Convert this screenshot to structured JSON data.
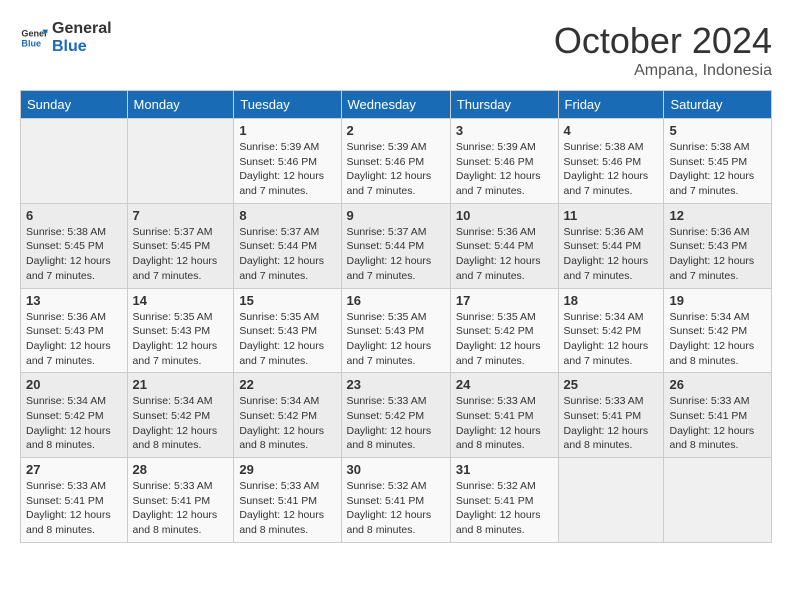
{
  "logo": {
    "text_general": "General",
    "text_blue": "Blue"
  },
  "header": {
    "month": "October 2024",
    "location": "Ampana, Indonesia"
  },
  "days_of_week": [
    "Sunday",
    "Monday",
    "Tuesday",
    "Wednesday",
    "Thursday",
    "Friday",
    "Saturday"
  ],
  "weeks": [
    [
      {
        "day": "",
        "info": ""
      },
      {
        "day": "",
        "info": ""
      },
      {
        "day": "1",
        "info": "Sunrise: 5:39 AM\nSunset: 5:46 PM\nDaylight: 12 hours\nand 7 minutes."
      },
      {
        "day": "2",
        "info": "Sunrise: 5:39 AM\nSunset: 5:46 PM\nDaylight: 12 hours\nand 7 minutes."
      },
      {
        "day": "3",
        "info": "Sunrise: 5:39 AM\nSunset: 5:46 PM\nDaylight: 12 hours\nand 7 minutes."
      },
      {
        "day": "4",
        "info": "Sunrise: 5:38 AM\nSunset: 5:46 PM\nDaylight: 12 hours\nand 7 minutes."
      },
      {
        "day": "5",
        "info": "Sunrise: 5:38 AM\nSunset: 5:45 PM\nDaylight: 12 hours\nand 7 minutes."
      }
    ],
    [
      {
        "day": "6",
        "info": "Sunrise: 5:38 AM\nSunset: 5:45 PM\nDaylight: 12 hours\nand 7 minutes."
      },
      {
        "day": "7",
        "info": "Sunrise: 5:37 AM\nSunset: 5:45 PM\nDaylight: 12 hours\nand 7 minutes."
      },
      {
        "day": "8",
        "info": "Sunrise: 5:37 AM\nSunset: 5:44 PM\nDaylight: 12 hours\nand 7 minutes."
      },
      {
        "day": "9",
        "info": "Sunrise: 5:37 AM\nSunset: 5:44 PM\nDaylight: 12 hours\nand 7 minutes."
      },
      {
        "day": "10",
        "info": "Sunrise: 5:36 AM\nSunset: 5:44 PM\nDaylight: 12 hours\nand 7 minutes."
      },
      {
        "day": "11",
        "info": "Sunrise: 5:36 AM\nSunset: 5:44 PM\nDaylight: 12 hours\nand 7 minutes."
      },
      {
        "day": "12",
        "info": "Sunrise: 5:36 AM\nSunset: 5:43 PM\nDaylight: 12 hours\nand 7 minutes."
      }
    ],
    [
      {
        "day": "13",
        "info": "Sunrise: 5:36 AM\nSunset: 5:43 PM\nDaylight: 12 hours\nand 7 minutes."
      },
      {
        "day": "14",
        "info": "Sunrise: 5:35 AM\nSunset: 5:43 PM\nDaylight: 12 hours\nand 7 minutes."
      },
      {
        "day": "15",
        "info": "Sunrise: 5:35 AM\nSunset: 5:43 PM\nDaylight: 12 hours\nand 7 minutes."
      },
      {
        "day": "16",
        "info": "Sunrise: 5:35 AM\nSunset: 5:43 PM\nDaylight: 12 hours\nand 7 minutes."
      },
      {
        "day": "17",
        "info": "Sunrise: 5:35 AM\nSunset: 5:42 PM\nDaylight: 12 hours\nand 7 minutes."
      },
      {
        "day": "18",
        "info": "Sunrise: 5:34 AM\nSunset: 5:42 PM\nDaylight: 12 hours\nand 7 minutes."
      },
      {
        "day": "19",
        "info": "Sunrise: 5:34 AM\nSunset: 5:42 PM\nDaylight: 12 hours\nand 8 minutes."
      }
    ],
    [
      {
        "day": "20",
        "info": "Sunrise: 5:34 AM\nSunset: 5:42 PM\nDaylight: 12 hours\nand 8 minutes."
      },
      {
        "day": "21",
        "info": "Sunrise: 5:34 AM\nSunset: 5:42 PM\nDaylight: 12 hours\nand 8 minutes."
      },
      {
        "day": "22",
        "info": "Sunrise: 5:34 AM\nSunset: 5:42 PM\nDaylight: 12 hours\nand 8 minutes."
      },
      {
        "day": "23",
        "info": "Sunrise: 5:33 AM\nSunset: 5:42 PM\nDaylight: 12 hours\nand 8 minutes."
      },
      {
        "day": "24",
        "info": "Sunrise: 5:33 AM\nSunset: 5:41 PM\nDaylight: 12 hours\nand 8 minutes."
      },
      {
        "day": "25",
        "info": "Sunrise: 5:33 AM\nSunset: 5:41 PM\nDaylight: 12 hours\nand 8 minutes."
      },
      {
        "day": "26",
        "info": "Sunrise: 5:33 AM\nSunset: 5:41 PM\nDaylight: 12 hours\nand 8 minutes."
      }
    ],
    [
      {
        "day": "27",
        "info": "Sunrise: 5:33 AM\nSunset: 5:41 PM\nDaylight: 12 hours\nand 8 minutes."
      },
      {
        "day": "28",
        "info": "Sunrise: 5:33 AM\nSunset: 5:41 PM\nDaylight: 12 hours\nand 8 minutes."
      },
      {
        "day": "29",
        "info": "Sunrise: 5:33 AM\nSunset: 5:41 PM\nDaylight: 12 hours\nand 8 minutes."
      },
      {
        "day": "30",
        "info": "Sunrise: 5:32 AM\nSunset: 5:41 PM\nDaylight: 12 hours\nand 8 minutes."
      },
      {
        "day": "31",
        "info": "Sunrise: 5:32 AM\nSunset: 5:41 PM\nDaylight: 12 hours\nand 8 minutes."
      },
      {
        "day": "",
        "info": ""
      },
      {
        "day": "",
        "info": ""
      }
    ]
  ]
}
